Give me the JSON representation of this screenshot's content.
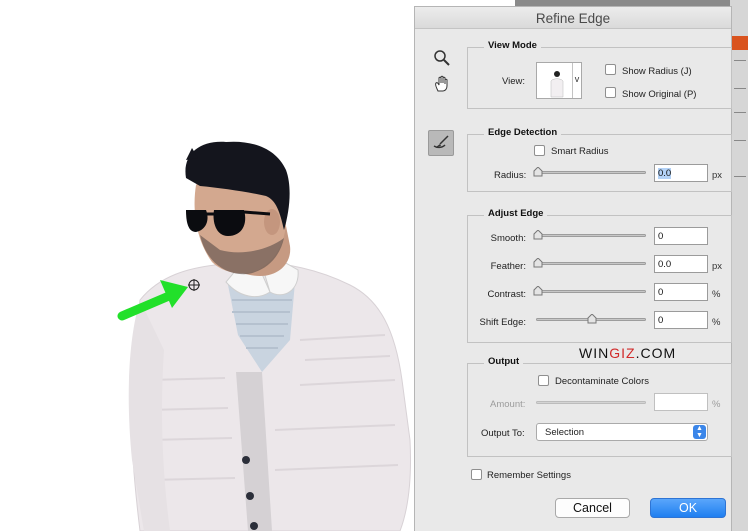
{
  "dialog": {
    "title": "Refine Edge",
    "tools": [
      {
        "icon": "zoom-tool-icon"
      },
      {
        "icon": "hand-tool-icon"
      },
      {
        "icon": "refine-radius-tool-icon"
      }
    ]
  },
  "view_mode": {
    "legend": "View Mode",
    "view_label": "View:",
    "dropdown_arrow": "v",
    "show_radius": {
      "label": "Show Radius (J)",
      "checked": false
    },
    "show_original": {
      "label": "Show Original (P)",
      "checked": false
    }
  },
  "edge_detection": {
    "legend": "Edge Detection",
    "smart_radius": {
      "label": "Smart Radius",
      "checked": false
    },
    "radius": {
      "label": "Radius:",
      "value": "0.0",
      "unit": "px",
      "slider_fraction": 0.0
    }
  },
  "adjust_edge": {
    "legend": "Adjust Edge",
    "rows": [
      {
        "label": "Smooth:",
        "value": "0",
        "unit": "",
        "slider_fraction": 0.0
      },
      {
        "label": "Feather:",
        "value": "0.0",
        "unit": "px",
        "slider_fraction": 0.0
      },
      {
        "label": "Contrast:",
        "value": "0",
        "unit": "%",
        "slider_fraction": 0.0
      },
      {
        "label": "Shift Edge:",
        "value": "0",
        "unit": "%",
        "slider_fraction": 0.5
      }
    ]
  },
  "output": {
    "legend": "Output",
    "decontaminate": {
      "label": "Decontaminate Colors",
      "checked": false
    },
    "amount": {
      "label": "Amount:",
      "value": "",
      "unit": "%"
    },
    "output_to": {
      "label": "Output To:",
      "value": "Selection"
    }
  },
  "remember_settings": {
    "label": "Remember Settings",
    "checked": false
  },
  "buttons": {
    "cancel": "Cancel",
    "ok": "OK"
  },
  "watermark": {
    "part1": "WIN",
    "part2": "GIZ",
    "part3": ".COM"
  },
  "colors": {
    "accent": "#1f7ff0",
    "arrow": "#22e02a",
    "dialog_bg": "#e9e9e9"
  }
}
